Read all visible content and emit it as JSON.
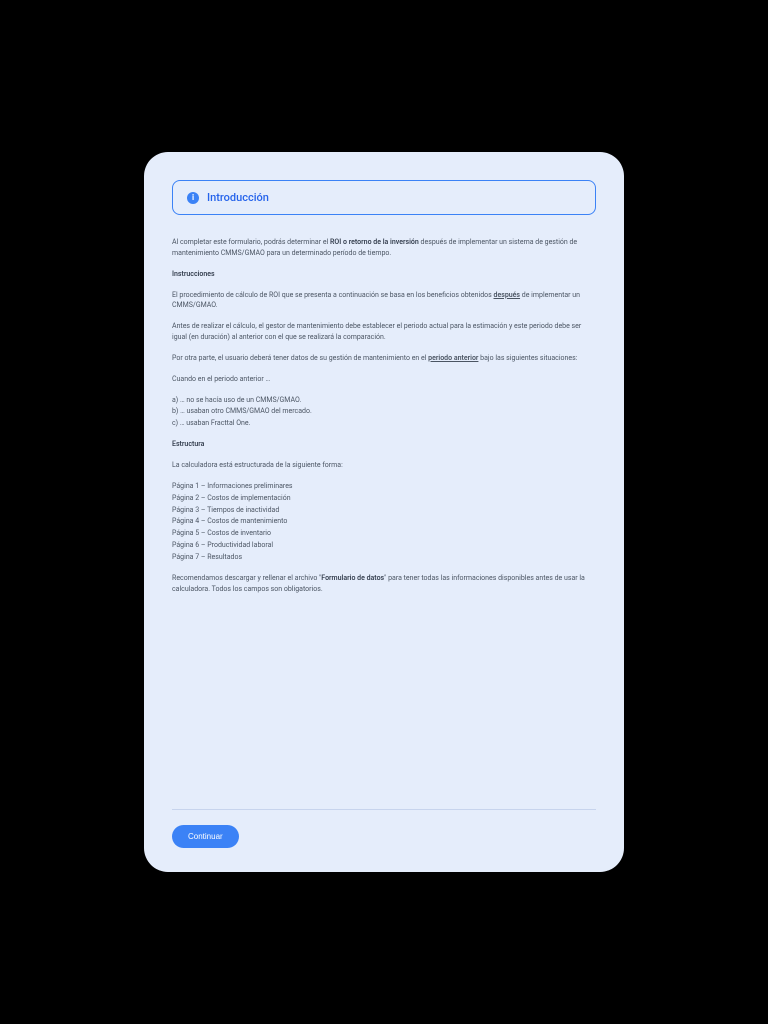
{
  "header": {
    "icon_glyph": "i",
    "title": "Introducción"
  },
  "intro": {
    "pre": "Al completar este formulario, podrás determinar el ",
    "bold": "ROI o retorno de la inversión",
    "post": " después de implementar un sistema de gestión de mantenimiento CMMS/GMAO para un determinado período de tiempo."
  },
  "instructions": {
    "heading": "Instrucciones",
    "p1_pre": "El procedimiento de cálculo de ROI que se presenta a continuación se basa en los beneficios obtenidos ",
    "p1_u": "después",
    "p1_post": " de implementar un CMMS/GMAO.",
    "p2": "Antes de realizar el cálculo, el gestor de mantenimiento debe establecer el periodo actual para la estimación y este periodo debe ser igual (en duración) al anterior con el que se realizará la comparación.",
    "p3_pre": "Por otra parte, el usuario deberá tener datos de su gestión de mantenimiento en el ",
    "p3_u": "periodo anterior",
    "p3_post": " bajo las siguientes situaciones:",
    "p4": "Cuando en el periodo anterior …",
    "list": [
      "a) … no se hacía uso de un CMMS/GMAO.",
      "b) … usaban otro CMMS/GMAO del mercado.",
      "c) … usaban Fracttal One."
    ]
  },
  "structure": {
    "heading": "Estructura",
    "intro": "La calculadora está estructurada de la siguiente forma:",
    "pages": [
      "Página 1 – Informaciones preliminares",
      "Página 2 – Costos de implementación",
      "Página 3 – Tiempos de inactividad",
      "Página 4 – Costos de mantenimiento",
      "Página 5 – Costos de inventario",
      "Página 6 – Productividad laboral",
      "Página 7 – Resultados"
    ],
    "rec_pre": "Recomendamos descargar y rellenar el archivo \"",
    "rec_bold": "Formulario de datos",
    "rec_post": "\" para tener todas las informaciones disponibles antes de usar la calculadora. Todos los campos son obligatorios."
  },
  "footer": {
    "continue_label": "Continuar"
  }
}
